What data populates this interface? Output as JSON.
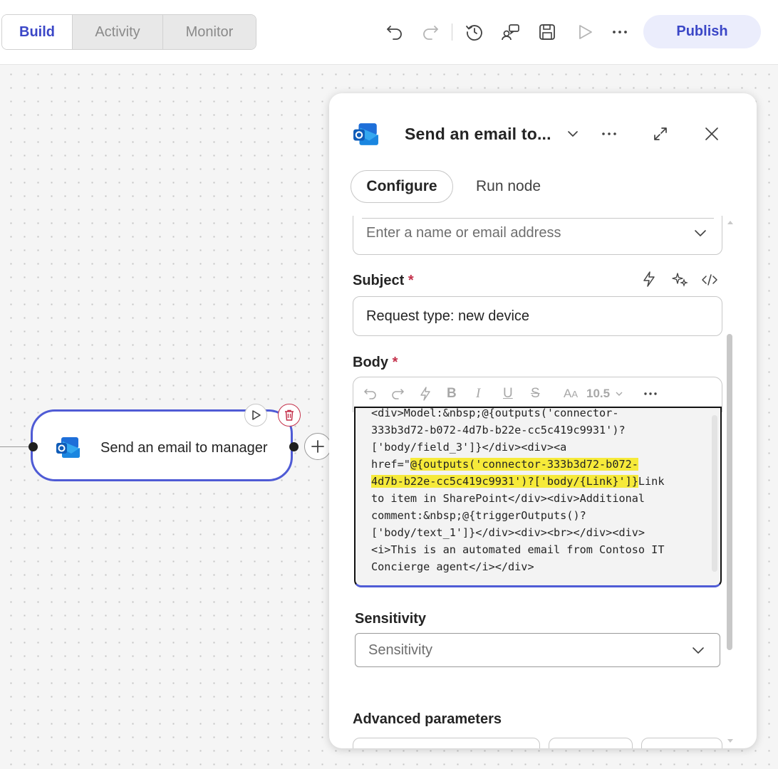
{
  "topbar": {
    "tabs": [
      {
        "label": "Build"
      },
      {
        "label": "Activity"
      },
      {
        "label": "Monitor"
      }
    ],
    "icons": [
      "undo-icon",
      "redo-icon",
      "history-icon",
      "feedback-icon",
      "save-icon",
      "play-icon",
      "more-icon"
    ],
    "publish_label": "Publish"
  },
  "canvas": {
    "node": {
      "label": "Send an email to manager",
      "icon": "outlook-icon"
    }
  },
  "panel": {
    "title": "Send an email to...",
    "tabs": {
      "configure": "Configure",
      "run_node": "Run node"
    },
    "to_field": {
      "placeholder": "Enter a name or email address"
    },
    "subject": {
      "label": "Subject",
      "required": "*",
      "value": "Request type: new device"
    },
    "body": {
      "label": "Body",
      "required": "*",
      "font_size": "10.5",
      "code_lines": [
        "<div>Model:&nbsp;@{outputs('connector-",
        "333b3d72-b072-4d7b-b22e-cc5c419c9931')?",
        "['body/field_3']}</div><div><a",
        "href=\"",
        "@{outputs('connector-333b3d72-b072-",
        "4d7b-b22e-cc5c419c9931')?['body/{Link}']}",
        "Link",
        "to item in SharePoint</div><div>Additional",
        "comment:&nbsp;@{triggerOutputs()?",
        "['body/text_1']}</div><div><br></div><div>",
        "<i>This is an automated email from Contoso IT",
        "Concierge agent</i></div>"
      ]
    },
    "sensitivity": {
      "label": "Sensitivity",
      "placeholder": "Sensitivity"
    },
    "advanced": {
      "label": "Advanced parameters"
    }
  },
  "colors": {
    "accent": "#3b47c7",
    "node_border": "#4f5bd5",
    "highlight": "#f6ea3a",
    "required": "#c4314b"
  }
}
